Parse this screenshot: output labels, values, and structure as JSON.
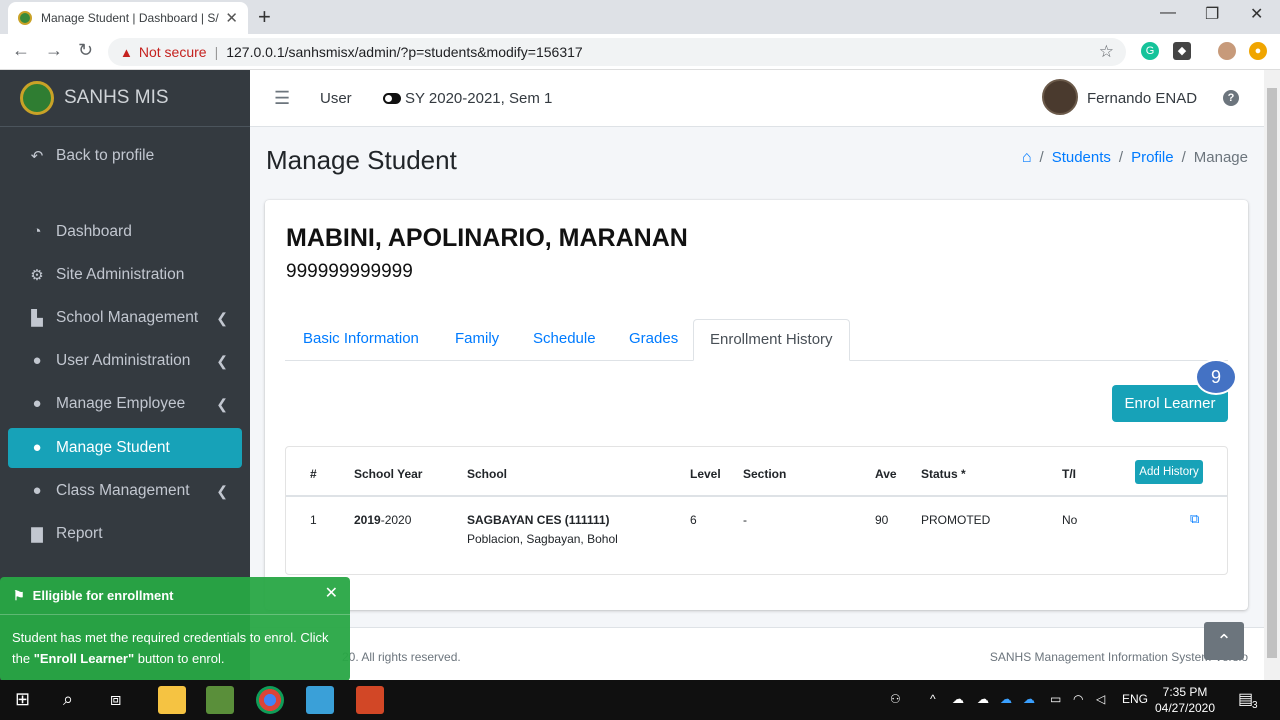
{
  "browser": {
    "tab_title": "Manage Student | Dashboard | SANHS MIS",
    "tab_title_visible": "Manage Student | Dashboard | S/",
    "not_secure": "Not secure",
    "url": "127.0.0.1/sanhsmisx/admin/?p=students&modify=156317"
  },
  "sidebar": {
    "brand": "SANHS MIS",
    "back": "Back to profile",
    "items": [
      {
        "label": "Dashboard"
      },
      {
        "label": "Site Administration"
      },
      {
        "label": "School Management"
      },
      {
        "label": "User Administration"
      },
      {
        "label": "Manage Employee"
      },
      {
        "label": "Manage Student"
      },
      {
        "label": "Class Management"
      },
      {
        "label": "Report"
      }
    ]
  },
  "topnav": {
    "user": "User",
    "sy": "SY 2020-2021, Sem 1",
    "username": "Fernando ENAD"
  },
  "page": {
    "title": "Manage Student",
    "breadcrumb": [
      "Students",
      "Profile",
      "Manage"
    ]
  },
  "student": {
    "name": "MABINI, APOLINARIO, MARANAN",
    "lrn": "999999999999"
  },
  "tabs": [
    "Basic Information",
    "Family",
    "Schedule",
    "Grades",
    "Enrollment History"
  ],
  "enrol_button": "Enrol Learner",
  "step_badge": "9",
  "table": {
    "headers": [
      "#",
      "School Year",
      "School",
      "Level",
      "Section",
      "Ave",
      "Status *",
      "T/I"
    ],
    "add_history": "Add History",
    "rows": [
      {
        "num": "1",
        "sy_start": "2019",
        "sy_end": "-2020",
        "school": "SAGBAYAN CES (111111)",
        "address": "Poblacion, Sagbayan, Bohol",
        "level": "6",
        "section": "-",
        "ave": "90",
        "status": "PROMOTED",
        "ti": "No"
      }
    ]
  },
  "footer": {
    "copyright": "20. All rights reserved.",
    "system": "SANHS Management Information System Versio"
  },
  "toast": {
    "title": "Elligible for enrollment",
    "body_prefix": "Student has met the required credentials to enrol. Click the ",
    "body_bold": "\"Enroll Learner\"",
    "body_suffix": " button to enrol."
  },
  "taskbar": {
    "lang": "ENG",
    "time": "7:35 PM",
    "date": "04/27/2020",
    "notif_count": "3"
  }
}
